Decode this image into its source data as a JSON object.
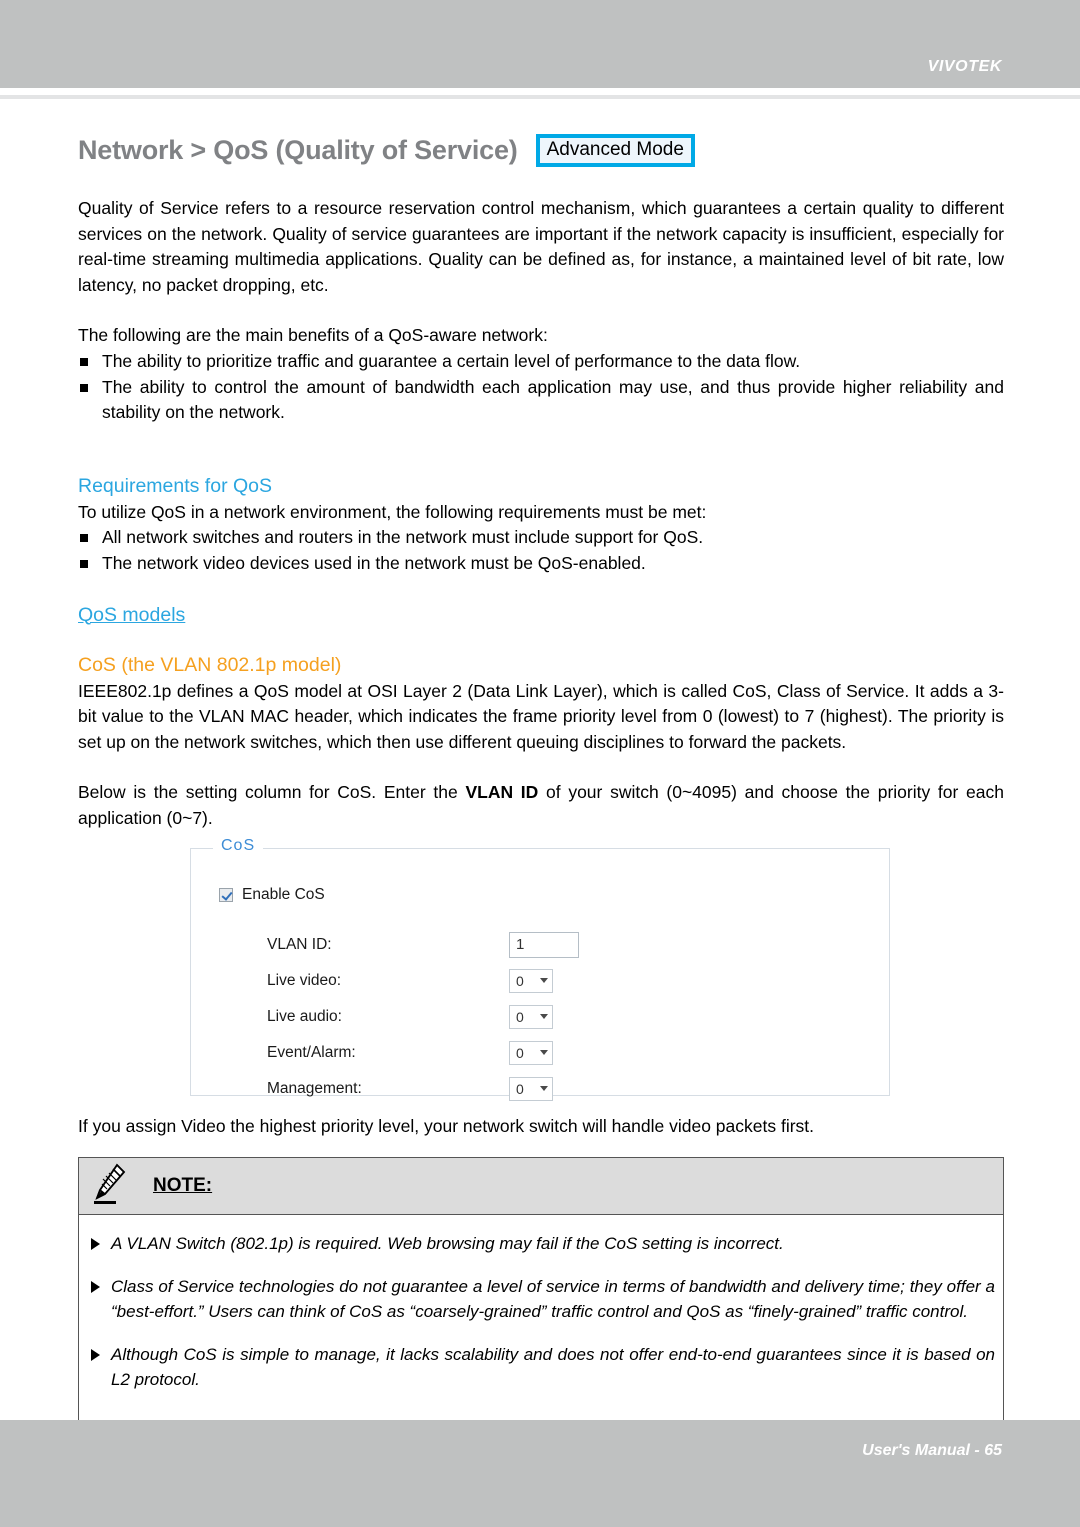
{
  "header": {
    "brand": "VIVOTEK"
  },
  "title": {
    "heading": "Network > QoS (Quality of Service)",
    "mode_badge": "Advanced Mode"
  },
  "intro": {
    "paragraph": "Quality of Service refers to a resource reservation control mechanism, which guarantees a certain quality to different services on the network. Quality of service guarantees are important if the network capacity is insufficient, especially for real-time streaming multimedia applications. Quality can be defined as, for instance, a maintained level of bit rate, low latency, no packet dropping, etc.",
    "benefits_lead": "The following are the main benefits of a QoS-aware network:",
    "benefits": [
      "The ability to prioritize traffic and guarantee a certain level of performance to the data flow.",
      "The ability to control the amount of bandwidth each application may use, and thus provide higher reliability and stability on the network."
    ]
  },
  "requirements": {
    "heading": "Requirements for QoS",
    "lead": "To utilize QoS in a network environment, the following requirements must be met:",
    "items": [
      "All network switches and routers in the network must include support for QoS.",
      "The network video devices used in the network must be QoS-enabled."
    ]
  },
  "models": {
    "heading": "QoS models",
    "cos_heading": "CoS (the VLAN 802.1p model)",
    "cos_paragraph": "IEEE802.1p defines a QoS model at OSI Layer 2 (Data Link Layer), which is called CoS, Class of Service. It adds a 3-bit value to the VLAN MAC header, which indicates the frame priority level from 0 (lowest) to 7 (highest). The priority is set up on the network switches, which then use different queuing disciplines to forward the packets.",
    "setting_intro_pre": "Below is the setting column for CoS. Enter the ",
    "setting_intro_bold": "VLAN ID",
    "setting_intro_post": " of your switch (0~4095) and choose the priority for each application (0~7)."
  },
  "cos_panel": {
    "legend": "CoS",
    "enable_label": "Enable CoS",
    "enable_checked": true,
    "fields": [
      {
        "label": "VLAN ID:",
        "value": "1",
        "control": "text"
      },
      {
        "label": "Live video:",
        "value": "0",
        "control": "select"
      },
      {
        "label": "Live audio:",
        "value": "0",
        "control": "select"
      },
      {
        "label": "Event/Alarm:",
        "value": "0",
        "control": "select"
      },
      {
        "label": "Management:",
        "value": "0",
        "control": "select"
      }
    ]
  },
  "after_panel": {
    "paragraph": "If you assign Video the highest priority level, your network switch will handle video packets first."
  },
  "note": {
    "title": "NOTE:",
    "icon": "pencil-icon",
    "items": [
      "A VLAN Switch (802.1p) is required. Web browsing may fail if the CoS setting is incorrect.",
      "Class of Service technologies do not guarantee a level of service in terms of bandwidth and delivery time; they offer a “best-effort.” Users can think of CoS as “coarsely-grained” traffic control and QoS as “finely-grained” traffic control.",
      "Although CoS is simple to manage, it lacks scalability and does not offer end-to-end guarantees since it is based on L2 protocol."
    ]
  },
  "footer": {
    "text": "User's Manual - 65"
  },
  "colors": {
    "header_bar": "#bfc1c1",
    "title_grey": "#808285",
    "badge_border": "#00a9e6",
    "section_blue": "#2ba6e0",
    "section_orange": "#f5a01f",
    "legend_blue": "#3c8cd6",
    "note_head_bg": "#dcdcdc"
  }
}
